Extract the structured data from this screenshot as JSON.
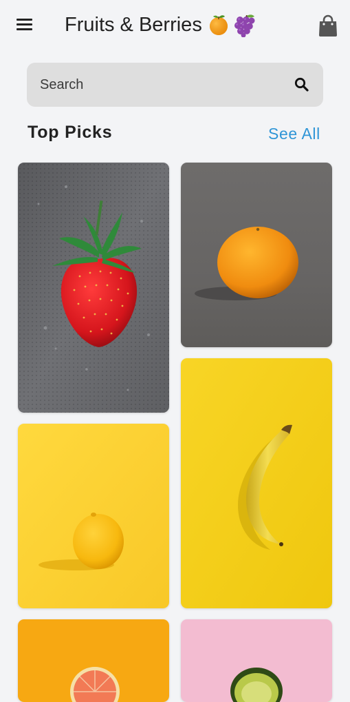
{
  "header": {
    "title": "Fruits & Berries",
    "title_emoji": [
      "🍊",
      "🍇"
    ],
    "menu_icon": "hamburger-menu-icon",
    "bag_icon": "shopping-bag-icon"
  },
  "search": {
    "placeholder": "Search",
    "value": "",
    "icon": "search-icon"
  },
  "section": {
    "title": "Top Picks",
    "see_all_label": "See All"
  },
  "products": [
    {
      "name": "strawberry",
      "background": "#6f7074"
    },
    {
      "name": "orange",
      "background": "#686766"
    },
    {
      "name": "lemon",
      "background": "#fbd53a"
    },
    {
      "name": "banana",
      "background": "#f3cf18"
    },
    {
      "name": "grapefruit",
      "background": "#f7a812"
    },
    {
      "name": "avocado",
      "background": "#f3bcd1"
    }
  ],
  "colors": {
    "background": "#f3f4f6",
    "search_background": "#dedede",
    "accent": "#2f95d6",
    "text": "#222222"
  }
}
